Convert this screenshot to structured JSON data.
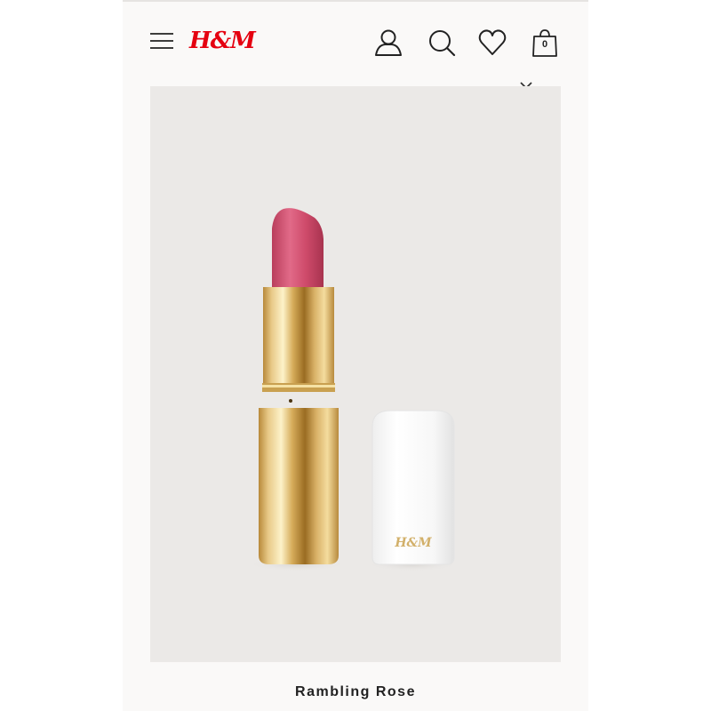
{
  "header": {
    "logo_text": "H&M",
    "bag_count": "0",
    "icons": [
      "menu-icon",
      "account-icon",
      "search-icon",
      "heart-icon",
      "bag-icon"
    ]
  },
  "product": {
    "name": "Rambling Rose",
    "cap_logo": "H&M"
  },
  "colors": {
    "brand": "#e50010",
    "lipstick": "#cf4b6b",
    "gold": "#d7b46a",
    "background": "#ebe9e7"
  }
}
